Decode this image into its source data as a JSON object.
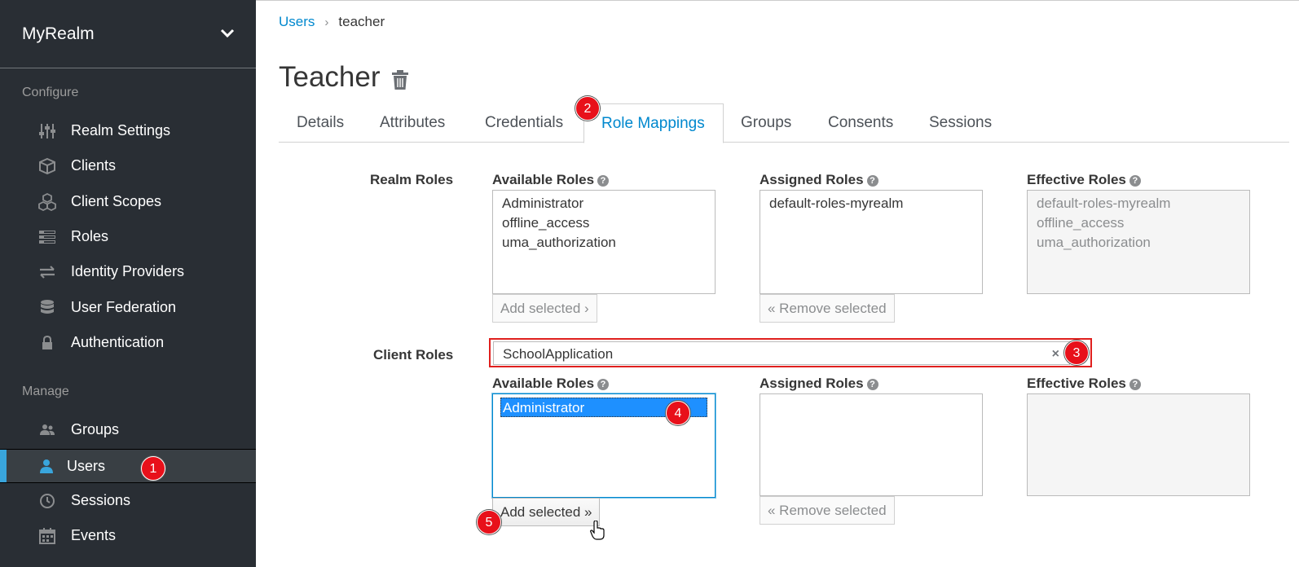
{
  "sidebar": {
    "realm_name": "MyRealm",
    "configure_label": "Configure",
    "manage_label": "Manage",
    "configure_items": [
      {
        "label": "Realm Settings",
        "icon": "sliders-icon"
      },
      {
        "label": "Clients",
        "icon": "cube-icon"
      },
      {
        "label": "Client Scopes",
        "icon": "cubes-icon"
      },
      {
        "label": "Roles",
        "icon": "list-icon"
      },
      {
        "label": "Identity Providers",
        "icon": "exchange-icon"
      },
      {
        "label": "User Federation",
        "icon": "database-icon"
      },
      {
        "label": "Authentication",
        "icon": "lock-icon"
      }
    ],
    "manage_items": [
      {
        "label": "Groups",
        "icon": "users-icon"
      },
      {
        "label": "Users",
        "icon": "user-icon"
      },
      {
        "label": "Sessions",
        "icon": "clock-icon"
      },
      {
        "label": "Events",
        "icon": "calendar-icon"
      }
    ]
  },
  "breadcrumb": {
    "parent": "Users",
    "separator": "›",
    "current": "teacher"
  },
  "page_title": "Teacher",
  "tabs": [
    "Details",
    "Attributes",
    "Credentials",
    "Role Mappings",
    "Groups",
    "Consents",
    "Sessions"
  ],
  "active_tab": "Role Mappings",
  "realm_roles": {
    "label": "Realm Roles",
    "available_header": "Available Roles",
    "assigned_header": "Assigned Roles",
    "effective_header": "Effective Roles",
    "available": [
      "Administrator",
      "offline_access",
      "uma_authorization"
    ],
    "assigned": [
      "default-roles-myrealm"
    ],
    "effective": [
      "default-roles-myrealm",
      "offline_access",
      "uma_authorization"
    ],
    "add_button": "Add selected ›",
    "remove_button": "« Remove selected"
  },
  "client_roles": {
    "label": "Client Roles",
    "client_select_value": "SchoolApplication",
    "clear_symbol": "×",
    "available_header": "Available Roles",
    "assigned_header": "Assigned Roles",
    "effective_header": "Effective Roles",
    "available": [
      "Administrator"
    ],
    "selected": "Administrator",
    "add_button": "Add selected »",
    "remove_button": "« Remove selected"
  },
  "help_glyph": "?",
  "annotations": [
    "1",
    "2",
    "3",
    "4",
    "5"
  ],
  "colors": {
    "sidebar_bg": "#292e34",
    "accent": "#0088ce",
    "badge": "#e8101a",
    "selection": "#1e90ff"
  }
}
